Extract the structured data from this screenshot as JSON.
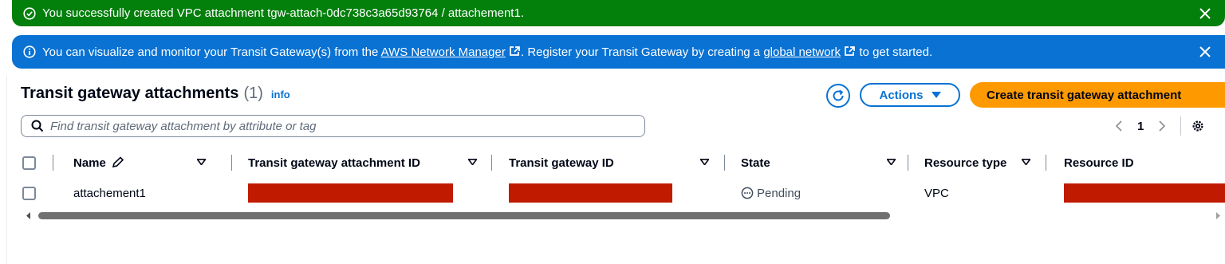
{
  "flash_success": {
    "text": "You successfully created VPC attachment tgw-attach-0dc738c3a65d93764 / attachement1.",
    "color": "#037f0c"
  },
  "flash_info": {
    "text_1": "You can visualize and monitor your Transit Gateway(s) from the ",
    "link_1": "AWS Network Manager",
    "text_2": ". Register your Transit Gateway by creating a ",
    "link_2": "global network",
    "text_3": " to get started.",
    "color": "#0972d3"
  },
  "header": {
    "title": "Transit gateway attachments",
    "count": "(1)",
    "info": "info"
  },
  "toolbar": {
    "actions_label": "Actions",
    "create_label": "Create transit gateway attachment",
    "accent_color": "#ff9900"
  },
  "search": {
    "placeholder": "Find transit gateway attachment by attribute or tag"
  },
  "pagination": {
    "current_page": "1"
  },
  "table": {
    "columns": [
      "Name",
      "Transit gateway attachment ID",
      "Transit gateway ID",
      "State",
      "Resource type",
      "Resource ID"
    ],
    "rows": [
      {
        "name": "attachement1",
        "attachment_id": "",
        "gateway_id": "",
        "state": "Pending",
        "resource_type": "VPC",
        "resource_id": ""
      }
    ],
    "redaction_color": "#c01a00"
  },
  "icons": {
    "success": "check-circle-icon",
    "info": "info-circle-icon",
    "close": "close-icon",
    "external": "external-link-icon",
    "refresh": "refresh-icon",
    "dropdown": "caret-down-icon",
    "search": "search-icon",
    "edit": "pencil-icon",
    "settings": "gear-icon",
    "pending": "pending-icon"
  }
}
